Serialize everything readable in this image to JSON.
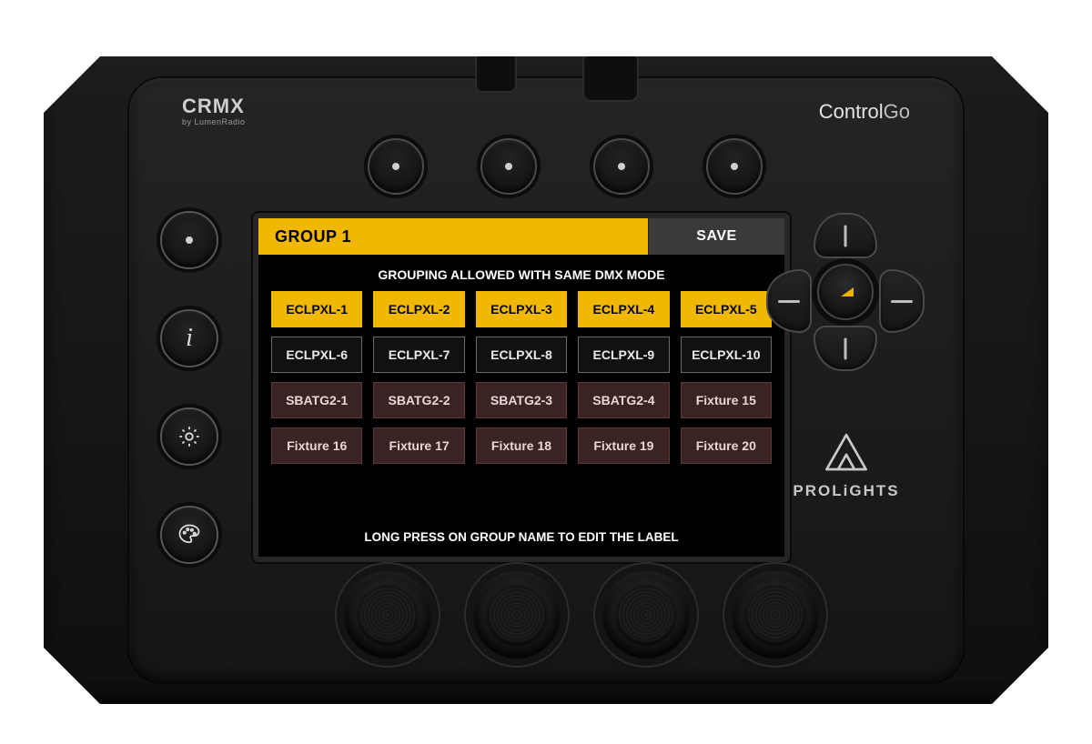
{
  "brand": {
    "crmx": "CRMX",
    "crmx_sub": "by LumenRadio",
    "product_prefix": "Control",
    "product_suffix": "Go",
    "prolights": "PROLiGHTS"
  },
  "screen": {
    "title": "GROUP 1",
    "save": "SAVE",
    "subtitle": "GROUPING ALLOWED WITH SAME DMX MODE",
    "footer": "LONG PRESS ON GROUP NAME TO EDIT THE LABEL",
    "fixtures": [
      {
        "label": "ECLPXL-1",
        "selected": true,
        "family": "a"
      },
      {
        "label": "ECLPXL-2",
        "selected": true,
        "family": "a"
      },
      {
        "label": "ECLPXL-3",
        "selected": true,
        "family": "a"
      },
      {
        "label": "ECLPXL-4",
        "selected": true,
        "family": "a"
      },
      {
        "label": "ECLPXL-5",
        "selected": true,
        "family": "a"
      },
      {
        "label": "ECLPXL-6",
        "selected": false,
        "family": "a"
      },
      {
        "label": "ECLPXL-7",
        "selected": false,
        "family": "a"
      },
      {
        "label": "ECLPXL-8",
        "selected": false,
        "family": "a"
      },
      {
        "label": "ECLPXL-9",
        "selected": false,
        "family": "a"
      },
      {
        "label": "ECLPXL-10",
        "selected": false,
        "family": "a"
      },
      {
        "label": "SBATG2-1",
        "selected": false,
        "family": "b"
      },
      {
        "label": "SBATG2-2",
        "selected": false,
        "family": "b"
      },
      {
        "label": "SBATG2-3",
        "selected": false,
        "family": "b"
      },
      {
        "label": "SBATG2-4",
        "selected": false,
        "family": "b"
      },
      {
        "label": "Fixture 15",
        "selected": false,
        "family": "b"
      },
      {
        "label": "Fixture 16",
        "selected": false,
        "family": "b"
      },
      {
        "label": "Fixture 17",
        "selected": false,
        "family": "b"
      },
      {
        "label": "Fixture 18",
        "selected": false,
        "family": "b"
      },
      {
        "label": "Fixture 19",
        "selected": false,
        "family": "b"
      },
      {
        "label": "Fixture 20",
        "selected": false,
        "family": "b"
      }
    ]
  },
  "colors": {
    "accent": "#f0b800",
    "panel": "#1a1a1a"
  }
}
